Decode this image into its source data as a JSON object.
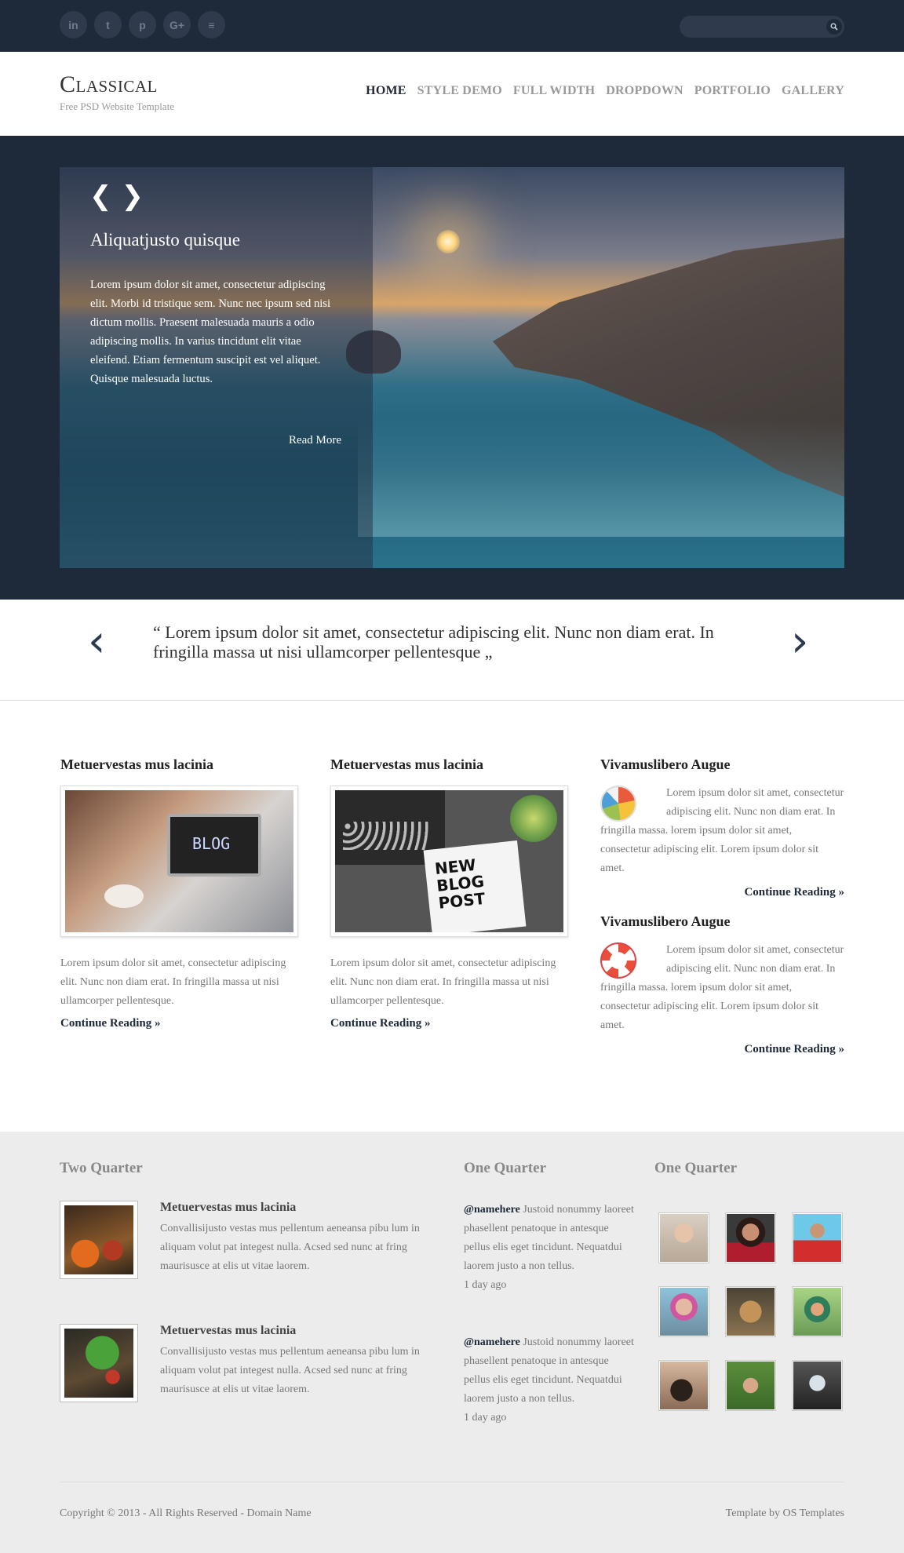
{
  "social": [
    {
      "icon": "linkedin-icon",
      "glyph": "in"
    },
    {
      "icon": "twitter-icon",
      "glyph": "t"
    },
    {
      "icon": "pinterest-icon",
      "glyph": "p"
    },
    {
      "icon": "google-plus-icon",
      "glyph": "G+"
    },
    {
      "icon": "rss-icon",
      "glyph": "≡"
    }
  ],
  "search": {
    "placeholder": ""
  },
  "header": {
    "logo": "Classical",
    "tagline": "Free PSD Website Template",
    "nav": [
      "HOME",
      "STYLE DEMO",
      "FULL WIDTH",
      "DROPDOWN",
      "PORTFOLIO",
      "GALLERY"
    ],
    "active_nav": "HOME"
  },
  "hero": {
    "prev": "❮",
    "next": "❯",
    "title": "Aliquatjusto quisque",
    "text": "Lorem ipsum dolor sit amet, consectetur adipiscing elit. Morbi id tristique sem. Nunc nec ipsum sed nisi dictum mollis. Praesent malesuada mauris a odio adipiscing mollis. In varius tincidunt elit vitae eleifend. Etiam fermentum suscipit est vel aliquet. Quisque malesuada luctus.",
    "read_more": "Read More"
  },
  "quote": {
    "prev": "‹",
    "next": "›",
    "text": "“ Lorem ipsum dolor sit amet, consectetur adipiscing elit. Nunc non diam erat. In fringilla massa ut nisi ullamcorper pellentesque „"
  },
  "posts": [
    {
      "title": "Metuervestas mus lacinia",
      "text": "Lorem ipsum dolor sit amet, consectetur adipiscing elit. Nunc non diam erat. In fringilla massa ut nisi ullamcorper pellentesque.",
      "link": "Continue Reading »",
      "image_text": "BLOG"
    },
    {
      "title": "Metuervestas mus lacinia",
      "text": "Lorem ipsum dolor sit amet, consectetur adipiscing elit. Nunc non diam erat. In fringilla massa ut nisi ullamcorper pellentesque.",
      "link": "Continue Reading »",
      "image_text": "NEW\nBLOG\nPOST"
    }
  ],
  "side": [
    {
      "title": "Vivamuslibero Augue",
      "icon": "pie-chart-icon",
      "text": "Lorem ipsum dolor sit amet, consectetur adipiscing elit. Nunc non diam erat. In fringilla massa. lorem ipsum dolor sit amet, consectetur adipiscing elit. Lorem ipsum dolor sit amet.",
      "link": "Continue Reading »"
    },
    {
      "title": "Vivamuslibero Augue",
      "icon": "lifebuoy-icon",
      "text": "Lorem ipsum dolor sit amet, consectetur adipiscing elit. Nunc non diam erat. In fringilla massa. lorem ipsum dolor sit amet, consectetur adipiscing elit. Lorem ipsum dolor sit amet.",
      "link": "Continue Reading »"
    }
  ],
  "footer": {
    "two_quarter_title": "Two Quarter",
    "one_quarter_title_1": "One Quarter",
    "one_quarter_title_2": "One Quarter",
    "items": [
      {
        "title": "Metuervestas mus lacinia",
        "text": "Convallisijusto vestas mus pellentum aeneansa pibu lum in aliquam volut pat integest nulla. Acsed sed nunc at fring maurisusce at elis ut vitae laorem."
      },
      {
        "title": "Metuervestas mus lacinia",
        "text": "Convallisijusto vestas mus pellentum aeneansa pibu lum in aliquam volut pat integest nulla. Acsed sed nunc at fring maurisusce at elis ut vitae laorem."
      }
    ],
    "tweets": [
      {
        "handle": "@namehere",
        "text": " Justoid nonummy laoreet phasellent penatoque in antesque pellus elis eget tincidunt. Nequatdui laorem justo a non tellus.",
        "time": "1 day ago"
      },
      {
        "handle": "@namehere",
        "text": " Justoid nonummy laoreet phasellent penatoque in antesque pellus elis eget tincidunt. Nequatdui laorem justo a non tellus.",
        "time": "1 day ago"
      }
    ],
    "copyright": "Copyright © 2013 - All Rights Reserved - Domain Name",
    "credit": "Template by OS Templates"
  }
}
